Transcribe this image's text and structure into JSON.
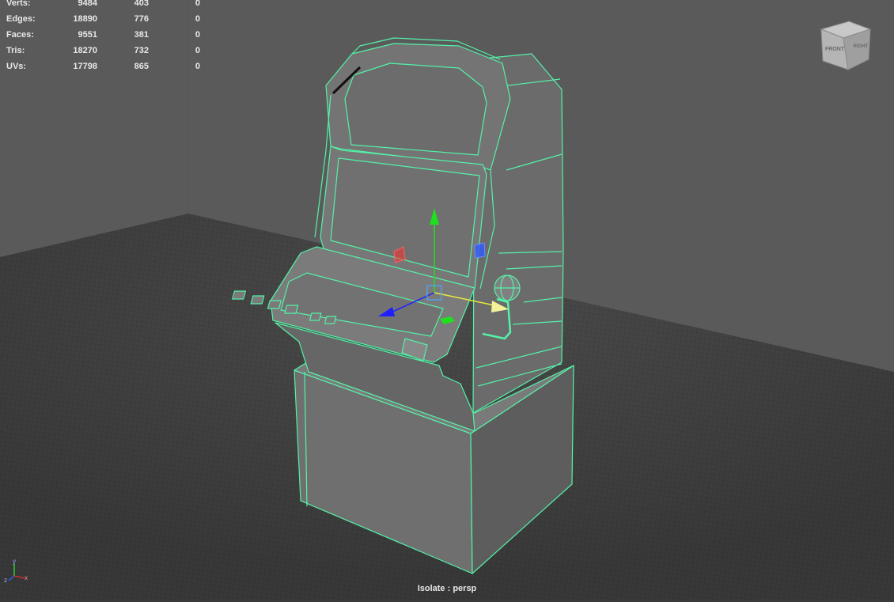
{
  "hud": {
    "rows": [
      {
        "label": "Verts:",
        "total": "9484",
        "selected": "403",
        "third": "0"
      },
      {
        "label": "Edges:",
        "total": "18890",
        "selected": "776",
        "third": "0"
      },
      {
        "label": "Faces:",
        "total": "9551",
        "selected": "381",
        "third": "0"
      },
      {
        "label": "Tris:",
        "total": "18270",
        "selected": "732",
        "third": "0"
      },
      {
        "label": "UVs:",
        "total": "17798",
        "selected": "865",
        "third": "0"
      }
    ]
  },
  "viewcube": {
    "front_label": "FRONT",
    "right_label": "RIGHT"
  },
  "axis_indicator": {
    "x_label": "x",
    "y_label": "y",
    "z_label": "z"
  },
  "camera_label": "Isolate : persp",
  "colors": {
    "wire": "#54f2a8",
    "background": "#5a5a5a",
    "grid": "#444444"
  }
}
